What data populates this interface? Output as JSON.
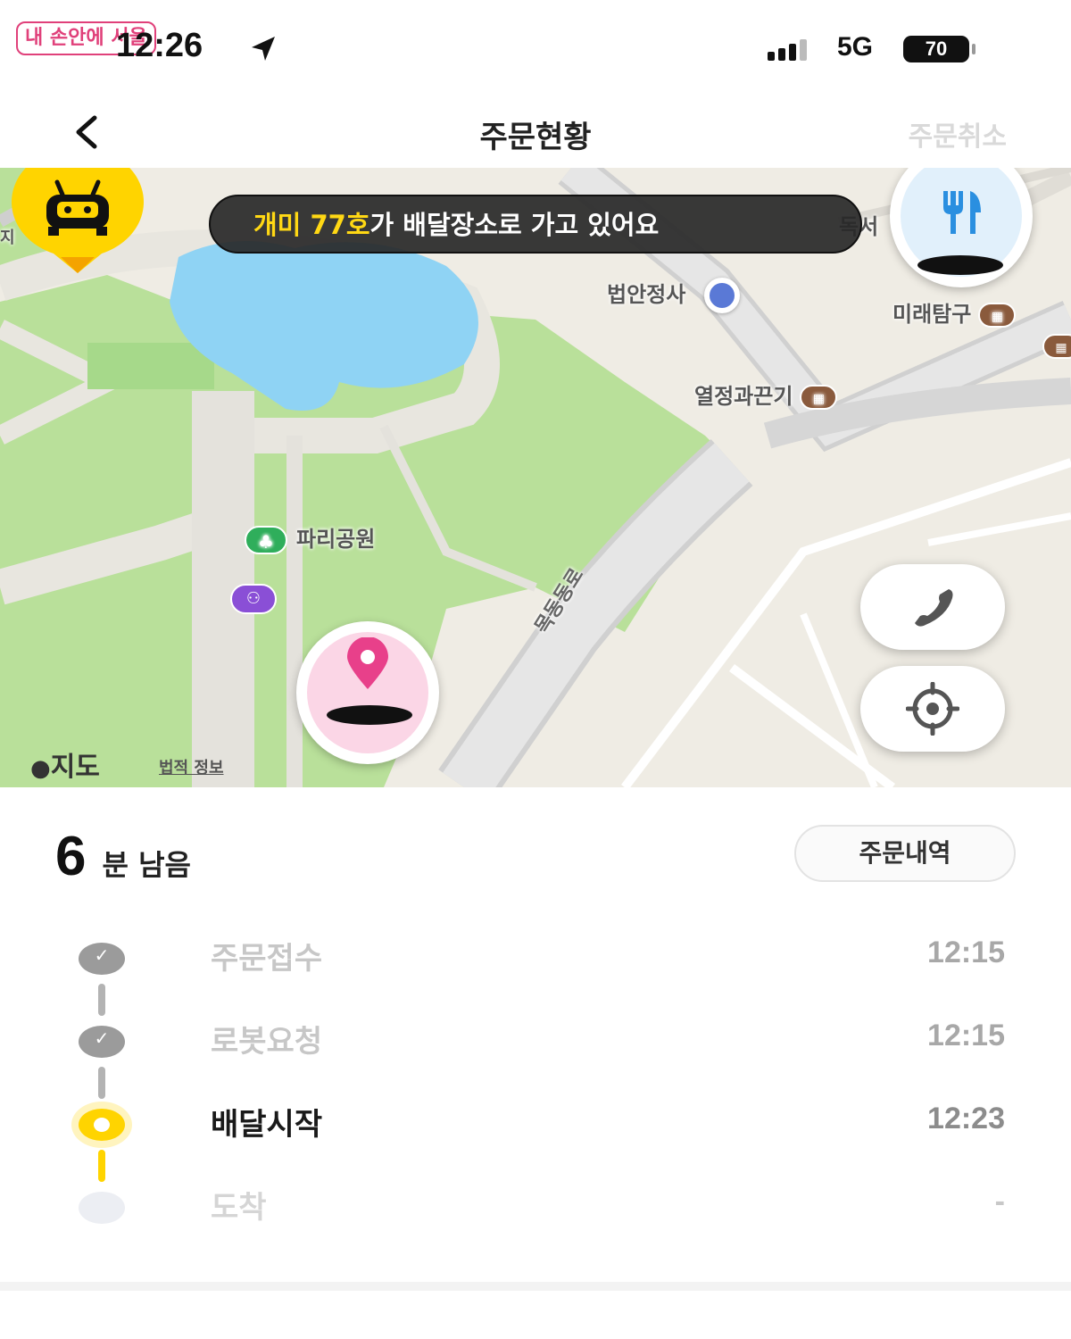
{
  "status_bar": {
    "watermark": "내 손안에 서울",
    "time": "12:26",
    "network": "5G",
    "battery": "70"
  },
  "header": {
    "title": "주문현황",
    "cancel_label": "주문취소"
  },
  "map": {
    "banner": {
      "robot_name": "개미 77호",
      "message": "가 배달장소로 가고 있어요"
    },
    "labels": {
      "building_left_edge": "지",
      "building_top_right": "독서",
      "legal_office": "법안정사",
      "future_explorer": "미래탐구",
      "passion": "열정과끈기",
      "park": "파리공원",
      "road": "목동동로"
    },
    "attribution": "지도",
    "legal_link": "법적 정보",
    "icons": {
      "restaurant_pin": "fork-knife-icon",
      "robot_pin": "robot-icon",
      "destination_pin": "location-pin-icon",
      "call_button": "phone-icon",
      "locate_button": "crosshair-icon",
      "park_marker": "tree-icon",
      "restroom_marker": "restroom-icon"
    }
  },
  "eta": {
    "value": "6",
    "unit": "분 남음"
  },
  "order_history_label": "주문내역",
  "steps": [
    {
      "label": "주문접수",
      "time": "12:15",
      "state": "done"
    },
    {
      "label": "로봇요청",
      "time": "12:15",
      "state": "done"
    },
    {
      "label": "배달시작",
      "time": "12:23",
      "state": "active"
    },
    {
      "label": "도착",
      "time": "-",
      "state": "pending"
    }
  ],
  "colors": {
    "accent": "#ffd400",
    "banner_bg": "#282828",
    "park_green": "#b9e09a",
    "water": "#8fd3f4",
    "destination_pink": "#e8408a",
    "restaurant_blue": "#2a8fe0"
  }
}
